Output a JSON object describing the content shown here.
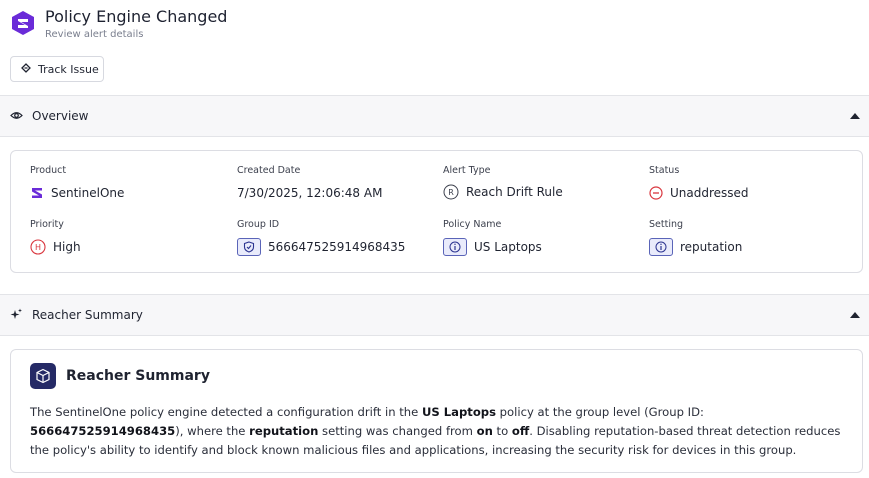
{
  "header": {
    "title": "Policy Engine Changed",
    "subtitle": "Review alert details",
    "logo_color": "#6a2bd8"
  },
  "toolbar": {
    "track_label": "Track Issue"
  },
  "overview": {
    "section_label": "Overview",
    "fields": {
      "product": {
        "label": "Product",
        "value": "SentinelOne",
        "icon": "sentinelone-logo-icon"
      },
      "created_date": {
        "label": "Created Date",
        "value": "7/30/2025, 12:06:48 AM"
      },
      "alert_type": {
        "label": "Alert Type",
        "value": "Reach Drift Rule",
        "icon": "r-circle-icon"
      },
      "status": {
        "label": "Status",
        "value": "Unaddressed",
        "icon": "minus-circle-icon",
        "color": "#d9363e"
      },
      "priority": {
        "label": "Priority",
        "value": "High",
        "icon": "h-circle-icon",
        "color": "#d9363e"
      },
      "group_id": {
        "label": "Group ID",
        "value": "566647525914968435",
        "icon": "shield-icon"
      },
      "policy_name": {
        "label": "Policy Name",
        "value": "US Laptops",
        "icon": "info-icon"
      },
      "setting": {
        "label": "Setting",
        "value": "reputation",
        "icon": "info-icon"
      }
    }
  },
  "reacher": {
    "section_label": "Reacher Summary",
    "card_title": "Reacher Summary",
    "text": {
      "p1": "The SentinelOne policy engine detected a configuration drift in the ",
      "b1": "US Laptops",
      "p2": " policy at the group level (Group ID: ",
      "b2": "566647525914968435",
      "p3": "), where the ",
      "b3": "reputation",
      "p4": " setting was changed from ",
      "b4": "on",
      "p5": " to ",
      "b5": "off",
      "p6": ". Disabling reputation-based threat detection reduces the policy's ability to identify and block known malicious files and applications, increasing the security risk for devices in this group."
    }
  }
}
